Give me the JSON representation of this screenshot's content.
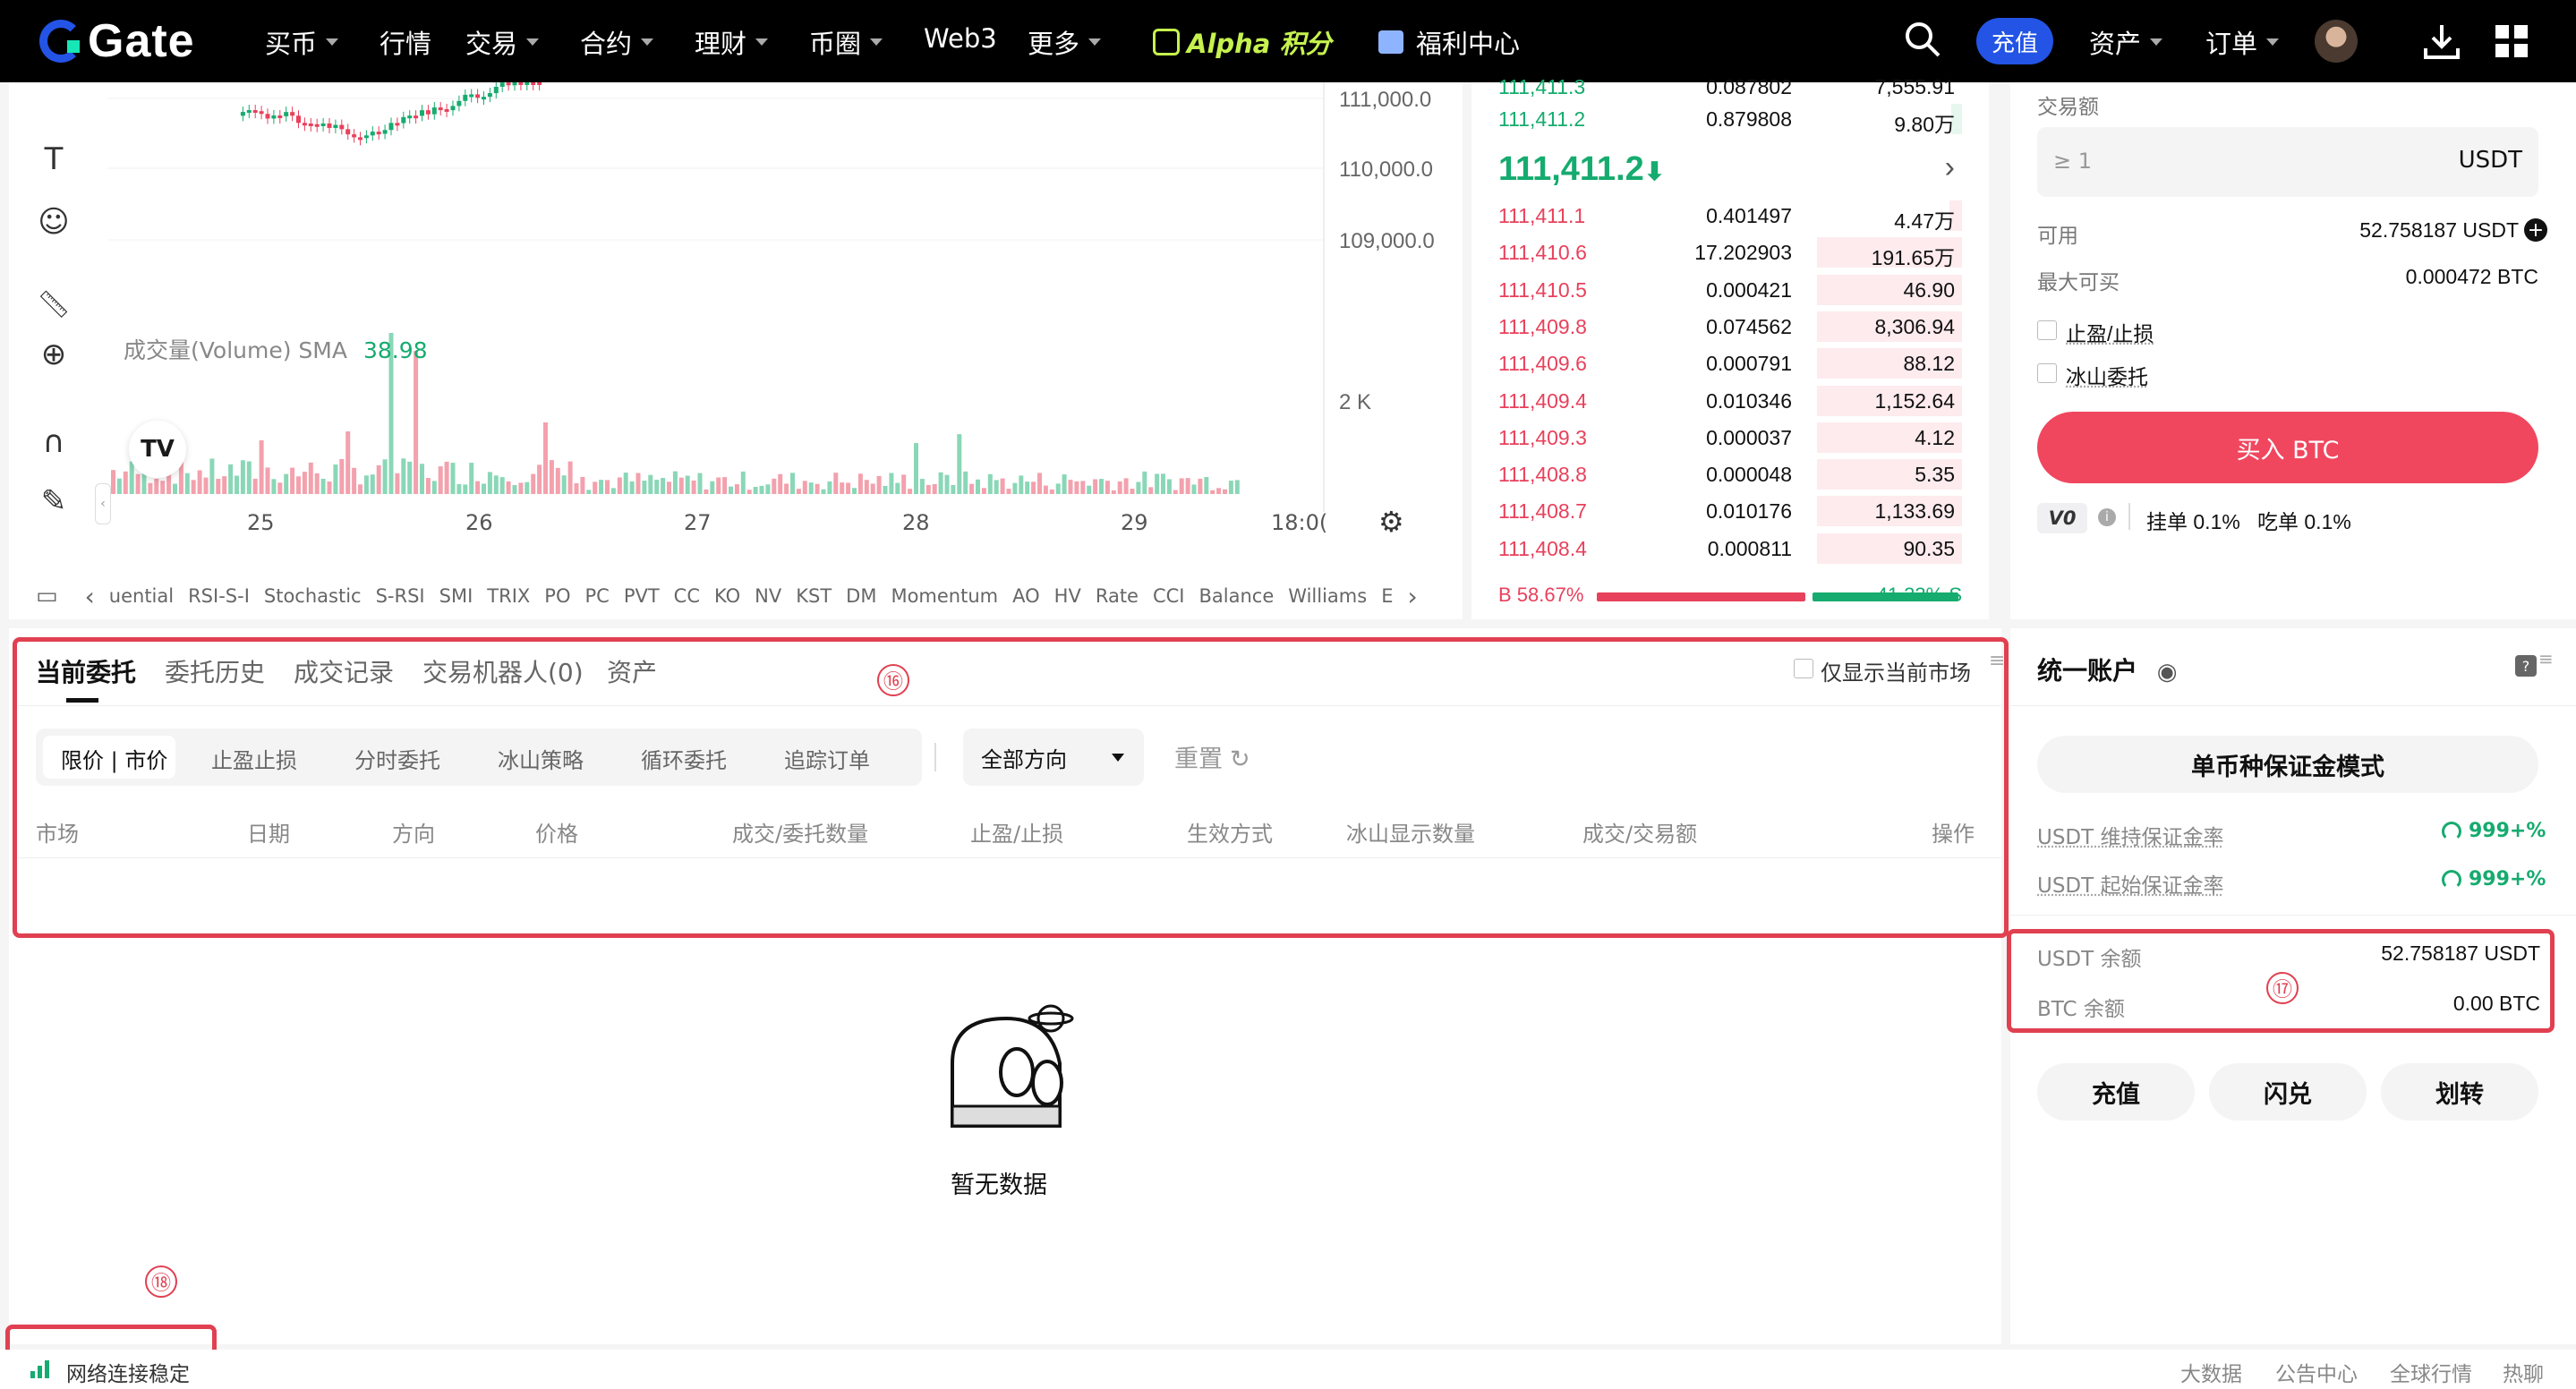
{
  "nav": {
    "logo_text": "Gate",
    "items": [
      {
        "label": "买币",
        "caret": true
      },
      {
        "label": "行情",
        "caret": false
      },
      {
        "label": "交易",
        "caret": true
      },
      {
        "label": "合约",
        "caret": true
      },
      {
        "label": "理财",
        "caret": true
      },
      {
        "label": "币圈",
        "caret": true
      },
      {
        "label": "Web3",
        "caret": false
      },
      {
        "label": "更多",
        "caret": true
      }
    ],
    "alpha_label": "Alpha 积分",
    "welfare_label": "福利中心",
    "deposit_label": "充值",
    "assets_label": "资产",
    "orders_label": "订单"
  },
  "chart": {
    "price_levels": [
      "111,000.0",
      "110,000.0",
      "109,000.0"
    ],
    "volume_label": "成交量(Volume) SMA",
    "volume_sma": "38.98",
    "volume_axis": "2 K",
    "dates": [
      "25",
      "26",
      "27",
      "28",
      "29",
      "18:0("
    ],
    "indicators": [
      "uential",
      "RSI-S-I",
      "Stochastic",
      "S-RSI",
      "SMI",
      "TRIX",
      "PO",
      "PC",
      "PVT",
      "CC",
      "KO",
      "NV",
      "KST",
      "DM",
      "Momentum",
      "AO",
      "HV",
      "Rate",
      "CCI",
      "Balance",
      "Williams",
      "E"
    ]
  },
  "orderbook": {
    "top_rows": [
      {
        "price": "111,411.3",
        "qty": "0.087802",
        "total": "7,555.91"
      },
      {
        "price": "111,411.2",
        "qty": "0.879808",
        "total": "9.80万"
      }
    ],
    "last_price": "111,411.2",
    "bid_rows": [
      {
        "price": "111,411.1",
        "qty": "0.401497",
        "total": "4.47万",
        "depth": 0.08
      },
      {
        "price": "111,410.6",
        "qty": "17.202903",
        "total": "191.65万",
        "depth": 0.9
      },
      {
        "price": "111,410.5",
        "qty": "0.000421",
        "total": "46.90",
        "depth": 0.9
      },
      {
        "price": "111,409.8",
        "qty": "0.074562",
        "total": "8,306.94",
        "depth": 0.9
      },
      {
        "price": "111,409.6",
        "qty": "0.000791",
        "total": "88.12",
        "depth": 0.9
      },
      {
        "price": "111,409.4",
        "qty": "0.010346",
        "total": "1,152.64",
        "depth": 0.9
      },
      {
        "price": "111,409.3",
        "qty": "0.000037",
        "total": "4.12",
        "depth": 0.9
      },
      {
        "price": "111,408.8",
        "qty": "0.000048",
        "total": "5.35",
        "depth": 0.9
      },
      {
        "price": "111,408.7",
        "qty": "0.010176",
        "total": "1,133.69",
        "depth": 0.9
      },
      {
        "price": "111,408.4",
        "qty": "0.000811",
        "total": "90.35",
        "depth": 0.9
      }
    ],
    "buy_ratio": "B 58.67%",
    "sell_ratio": "41.33% S",
    "buy_ratio_value": 0.5867
  },
  "tradeform": {
    "amount_label": "交易额",
    "amount_placeholder": "≥ 1",
    "amount_unit": "USDT",
    "available_label": "可用",
    "available_value": "52.758187 USDT",
    "max_buy_label": "最大可买",
    "max_buy_value": "0.000472 BTC",
    "tpsl_label": "止盈/止损",
    "iceberg_label": "冰山委托",
    "buy_button": "买入 BTC",
    "vip_level": "V0",
    "maker_fee": "挂单 0.1%",
    "taker_fee": "吃单 0.1%"
  },
  "orders": {
    "tabs": [
      "当前委托",
      "委托历史",
      "成交记录",
      "交易机器人(0)",
      "资产"
    ],
    "only_current_label": "仅显示当前市场",
    "subtabs": [
      "限价 | 市价",
      "止盈止损",
      "分时委托",
      "冰山策略",
      "循环委托",
      "追踪订单"
    ],
    "direction_select": "全部方向",
    "reset_label": "重置",
    "columns": [
      "市场",
      "日期",
      "方向",
      "价格",
      "成交/委托数量",
      "止盈/止损",
      "生效方式",
      "冰山显示数量",
      "成交/交易额",
      "操作"
    ],
    "empty_text": "暂无数据"
  },
  "account": {
    "title": "统一账户",
    "mode_button": "单币种保证金模式",
    "maint_label": "USDT 维持保证金率",
    "maint_value": "999+%",
    "init_label": "USDT 起始保证金率",
    "init_value": "999+%",
    "usdt_label": "USDT 余额",
    "usdt_value": "52.758187 USDT",
    "btc_label": "BTC 余额",
    "btc_value": "0.00 BTC",
    "buttons": [
      "充值",
      "闪兑",
      "划转"
    ]
  },
  "annotations": {
    "n16": "⑯",
    "n17": "⑰",
    "n18": "⑱"
  },
  "statusbar": {
    "network": "网络连接稳定",
    "links": [
      "大数据",
      "公告中心",
      "全球行情",
      "热聊"
    ]
  },
  "colors": {
    "up": "#16ab6f",
    "down": "#e8415c",
    "brand": "#2354e6",
    "annotation": "#e04050"
  }
}
